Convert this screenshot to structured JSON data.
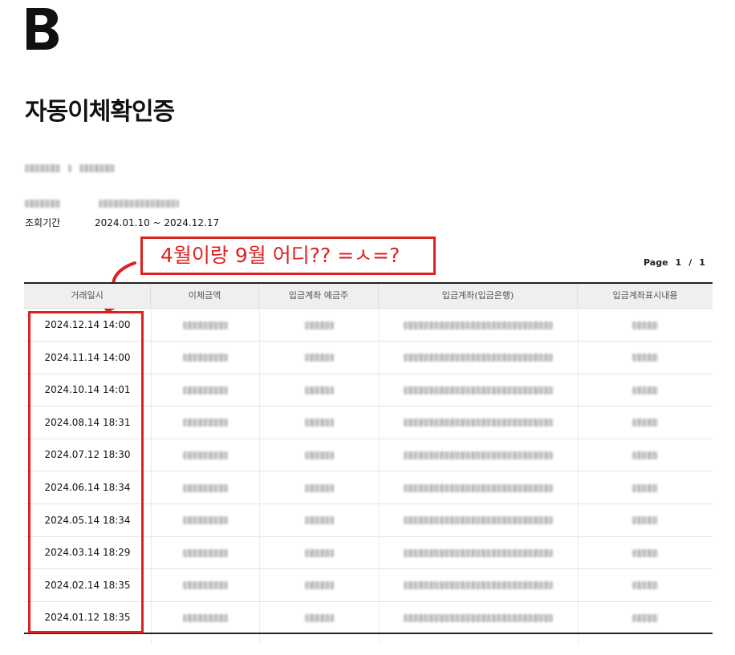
{
  "document": {
    "title": "자동이체확인증",
    "period_label": "조회기간",
    "period_value": "2024.01.10 ~ 2024.12.17"
  },
  "annotation": {
    "text": "4월이랑 9월 어디?? =ㅅ=?"
  },
  "pagination": {
    "label": "Page",
    "current": "1",
    "separator": "/",
    "total": "1"
  },
  "table": {
    "headers": [
      "거래일시",
      "이체금액",
      "입금계좌 예금주",
      "입금계좌(입금은행)",
      "입금계좌표시내용"
    ],
    "rows": [
      {
        "datetime": "2024.12.14  14:00"
      },
      {
        "datetime": "2024.11.14  14:00"
      },
      {
        "datetime": "2024.10.14  14:01"
      },
      {
        "datetime": "2024.08.14  18:31"
      },
      {
        "datetime": "2024.07.12  18:30"
      },
      {
        "datetime": "2024.06.14  18:34"
      },
      {
        "datetime": "2024.05.14  18:34"
      },
      {
        "datetime": "2024.03.14  18:29"
      },
      {
        "datetime": "2024.02.14  18:35"
      },
      {
        "datetime": "2024.01.12  18:35"
      }
    ]
  },
  "colors": {
    "annotation_red": "#e02020",
    "header_bg": "#efefef"
  }
}
